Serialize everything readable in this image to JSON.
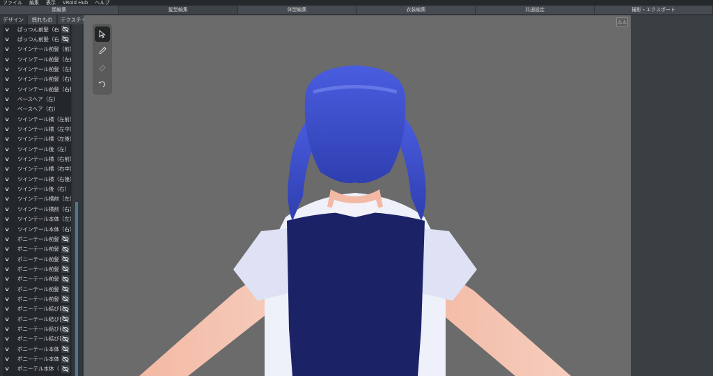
{
  "menu": [
    "ファイル",
    "編集",
    "表示",
    "VRoid Hub",
    "ヘルプ"
  ],
  "mode_tabs": [
    "顔編集",
    "髪型編集",
    "体型編集",
    "衣装編集",
    "共通設定",
    "撮影・エクスポート"
  ],
  "active_mode_tab": "髪型編集",
  "side_tabs": [
    "デザイン",
    "揺れもの",
    "テクスチャ"
  ],
  "active_side_tab": "デザイン",
  "hair_groups": [
    {
      "label": "ぱっつん前髪（右",
      "hidden": true
    },
    {
      "label": "ぱっつん前髪（右",
      "hidden": true
    },
    {
      "label": "ツインテール前髪（前）",
      "hidden": false
    },
    {
      "label": "ツインテール前髪（左前",
      "hidden": false
    },
    {
      "label": "ツインテール前髪（左後",
      "hidden": false
    },
    {
      "label": "ツインテール前髪（右前",
      "hidden": false
    },
    {
      "label": "ツインテール前髪（右後",
      "hidden": false
    },
    {
      "label": "ベースヘア（左）",
      "hidden": false
    },
    {
      "label": "ベースヘア（右）",
      "hidden": false
    },
    {
      "label": "ツインテール横（左前）",
      "hidden": false
    },
    {
      "label": "ツインテール横（左中）",
      "hidden": false
    },
    {
      "label": "ツインテール横（左後）",
      "hidden": false
    },
    {
      "label": "ツインテール後（左）",
      "hidden": false
    },
    {
      "label": "ツインテール横（右前）",
      "hidden": false
    },
    {
      "label": "ツインテール横（右中）",
      "hidden": false
    },
    {
      "label": "ツインテール横（右後）",
      "hidden": false
    },
    {
      "label": "ツインテール後（右）",
      "hidden": false
    },
    {
      "label": "ツインテール横前（左）",
      "hidden": false
    },
    {
      "label": "ツインテール横前（右）",
      "hidden": false
    },
    {
      "label": "ツインテール本体（左）",
      "hidden": false
    },
    {
      "label": "ツインテール本体（右）",
      "hidden": false
    },
    {
      "label": "ポニーテール前髪（",
      "hidden": true
    },
    {
      "label": "ポニーテール前髪（",
      "hidden": true
    },
    {
      "label": "ポニーテール前髪（",
      "hidden": true
    },
    {
      "label": "ポニーテール前髪（",
      "hidden": true
    },
    {
      "label": "ポニーテール前髪（",
      "hidden": true
    },
    {
      "label": "ポニーテール前髪（",
      "hidden": true
    },
    {
      "label": "ポニーテール前髪（",
      "hidden": true
    },
    {
      "label": "ポニーテール結び目",
      "hidden": true
    },
    {
      "label": "ポニーテール結び目",
      "hidden": true
    },
    {
      "label": "ポニーテール結び目",
      "hidden": true
    },
    {
      "label": "ポニーテール結び目",
      "hidden": true
    },
    {
      "label": "ポニーテール本体（",
      "hidden": true
    },
    {
      "label": "ポニーテール本体（",
      "hidden": true
    },
    {
      "label": "ポニーテル本体（",
      "hidden": true
    }
  ],
  "tools": [
    "select-tool",
    "brush-tool",
    "eraser-tool",
    "undo-tool"
  ],
  "view_button": "⏃⏃",
  "colors": {
    "hair": "#3d4fc8",
    "vest": "#1a1f5e",
    "viewport": "#6b6b6b",
    "accent": "#4f7792"
  }
}
